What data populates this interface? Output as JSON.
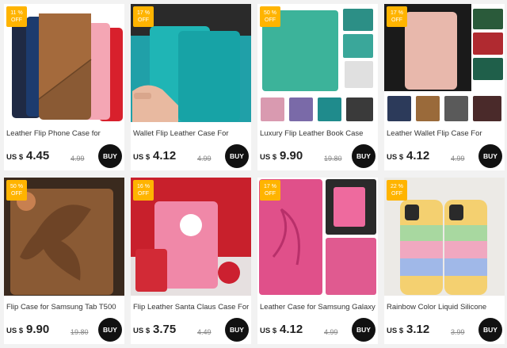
{
  "products": [
    {
      "badge": {
        "pct": "11 %",
        "off": "OFF"
      },
      "title": "Leather Flip Phone Case for",
      "currency": "US $",
      "price": "4.45",
      "original": "4.99",
      "buy": "BUY"
    },
    {
      "badge": {
        "pct": "17 %",
        "off": "OFF"
      },
      "title": "Wallet Flip Leather Case For",
      "currency": "US $",
      "price": "4.12",
      "original": "4.99",
      "buy": "BUY"
    },
    {
      "badge": {
        "pct": "50 %",
        "off": "OFF"
      },
      "title": "Luxury Flip Leather Book Case",
      "currency": "US $",
      "price": "9.90",
      "original": "19.80",
      "buy": "BUY"
    },
    {
      "badge": {
        "pct": "17 %",
        "off": "OFF"
      },
      "title": "Leather Wallet Flip Case For",
      "currency": "US $",
      "price": "4.12",
      "original": "4.99",
      "buy": "BUY"
    },
    {
      "badge": {
        "pct": "50 %",
        "off": "OFF"
      },
      "title": "Flip Case for Samsung Tab T500",
      "currency": "US $",
      "price": "9.90",
      "original": "19.80",
      "buy": "BUY"
    },
    {
      "badge": {
        "pct": "16 %",
        "off": "OFF"
      },
      "title": "Flip Leather Santa Claus Case For",
      "currency": "US $",
      "price": "3.75",
      "original": "4.49",
      "buy": "BUY"
    },
    {
      "badge": {
        "pct": "17 %",
        "off": "OFF"
      },
      "title": "Leather Case for Samsung Galaxy",
      "currency": "US $",
      "price": "4.12",
      "original": "4.99",
      "buy": "BUY"
    },
    {
      "badge": {
        "pct": "22 %",
        "off": "OFF"
      },
      "title": "Rainbow Color Liquid Silicone",
      "currency": "US $",
      "price": "3.12",
      "original": "3.99",
      "buy": "BUY"
    }
  ],
  "colors": {
    "badge": "#ffb400",
    "buy_button": "#111111",
    "page_bg": "#f2f2f2"
  }
}
